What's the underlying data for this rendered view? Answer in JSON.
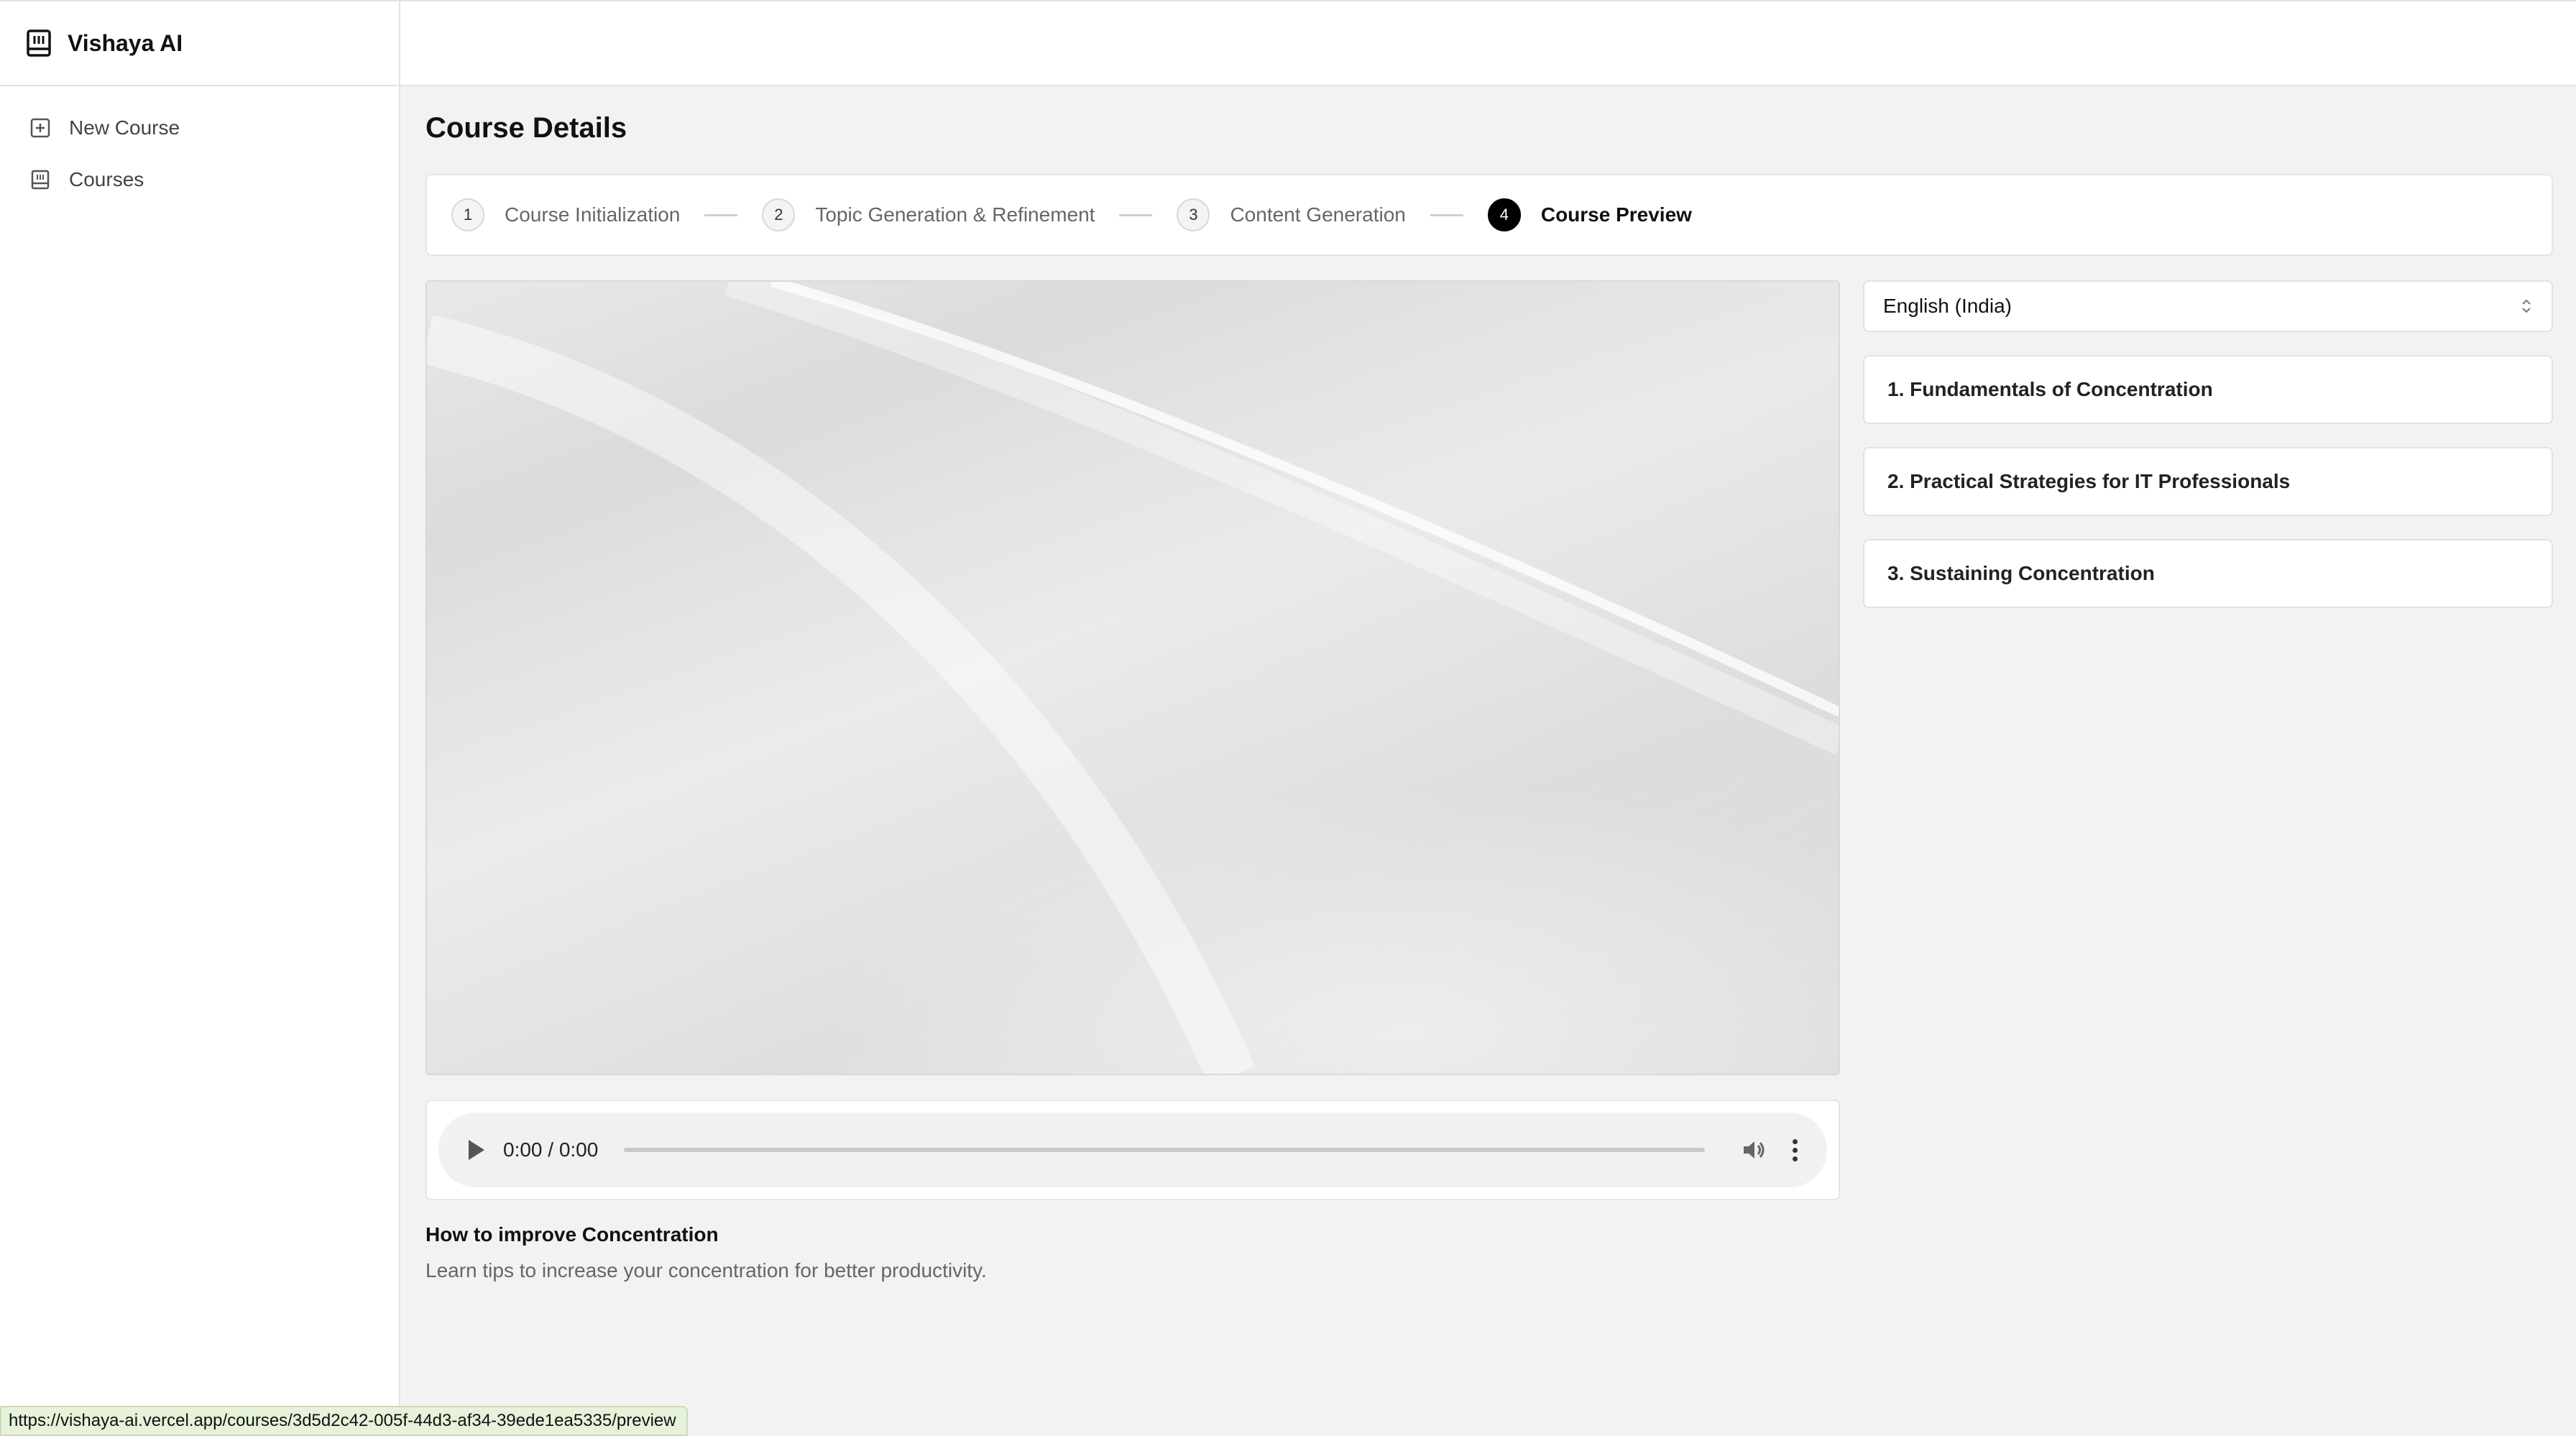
{
  "app": {
    "name": "Vishaya AI",
    "logo_icon": "book-icon"
  },
  "sidebar": {
    "items": [
      {
        "label": "New Course",
        "icon": "plus-square-icon"
      },
      {
        "label": "Courses",
        "icon": "book-icon"
      }
    ]
  },
  "page": {
    "title": "Course Details"
  },
  "stepper": {
    "steps": [
      {
        "number": "1",
        "label": "Course Initialization",
        "active": false
      },
      {
        "number": "2",
        "label": "Topic Generation & Refinement",
        "active": false
      },
      {
        "number": "3",
        "label": "Content Generation",
        "active": false
      },
      {
        "number": "4",
        "label": "Course Preview",
        "active": true
      }
    ]
  },
  "audio": {
    "time": "0:00 / 0:00",
    "progress_fraction": 0
  },
  "course": {
    "title": "How to improve Concentration",
    "description": "Learn tips to increase your concentration for better productivity."
  },
  "language_select": {
    "value": "English (India)"
  },
  "topics": [
    "1. Fundamentals of Concentration",
    "2. Practical Strategies for IT Professionals",
    "3. Sustaining Concentration"
  ],
  "status_bar": {
    "url": "https://vishaya-ai.vercel.app/courses/3d5d2c42-005f-44d3-af34-39ede1ea5335/preview"
  },
  "colors": {
    "background": "#f2f2f2",
    "active_step": "#000000",
    "status_bg": "#e6f2da"
  }
}
